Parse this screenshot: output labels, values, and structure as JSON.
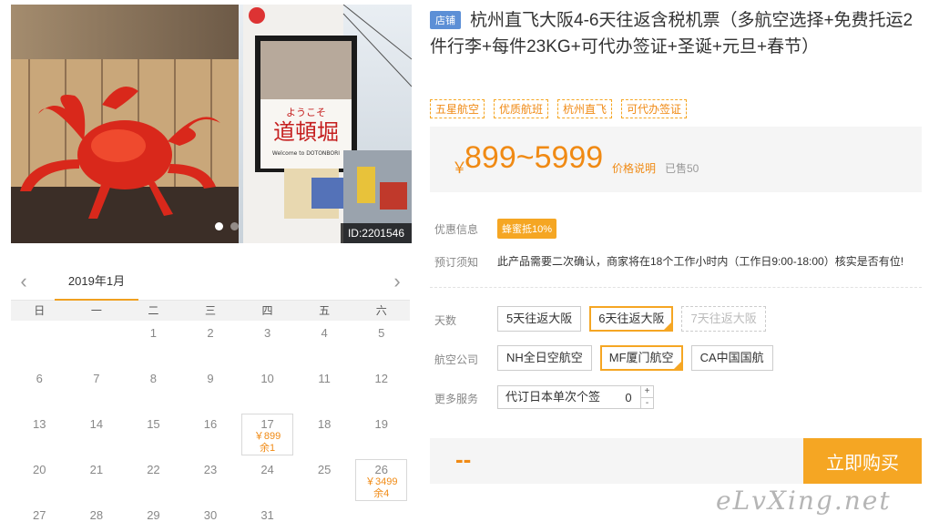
{
  "photo": {
    "id_label": "ID:2201546",
    "sign_text_small": "ようこそ",
    "sign_text_big": "道頓堀",
    "sign_text_sub": "Welcome to DOTONBORI",
    "slide_count": 2,
    "active_slide": 1
  },
  "calendar": {
    "month_label": "2019年1月",
    "prev_icon": "chevron-left-icon",
    "next_icon": "chevron-right-icon",
    "weekdays": [
      "日",
      "一",
      "二",
      "三",
      "四",
      "五",
      "六"
    ],
    "days": [
      {
        "day": ""
      },
      {
        "day": ""
      },
      {
        "day": "1"
      },
      {
        "day": "2"
      },
      {
        "day": "3"
      },
      {
        "day": "4"
      },
      {
        "day": "5"
      },
      {
        "day": "6"
      },
      {
        "day": "7"
      },
      {
        "day": "8"
      },
      {
        "day": "9"
      },
      {
        "day": "10"
      },
      {
        "day": "11"
      },
      {
        "day": "12"
      },
      {
        "day": "13"
      },
      {
        "day": "14"
      },
      {
        "day": "15"
      },
      {
        "day": "16"
      },
      {
        "day": "17",
        "price": "￥899",
        "stock": "余1"
      },
      {
        "day": "18"
      },
      {
        "day": "19"
      },
      {
        "day": "20"
      },
      {
        "day": "21"
      },
      {
        "day": "22"
      },
      {
        "day": "23"
      },
      {
        "day": "24"
      },
      {
        "day": "25"
      },
      {
        "day": "26",
        "price": "￥3499",
        "stock": "余4"
      },
      {
        "day": "27"
      },
      {
        "day": "28"
      },
      {
        "day": "29"
      },
      {
        "day": "30"
      },
      {
        "day": "31"
      },
      {
        "day": ""
      },
      {
        "day": ""
      }
    ]
  },
  "product": {
    "shop_badge": "店铺",
    "title": "杭州直飞大阪4-6天往返含税机票（多航空选择+免费托运2件行李+每件23KG+可代办签证+圣诞+元旦+春节）",
    "tags": [
      "五星航空",
      "优质航班",
      "杭州直飞",
      "可代办签证"
    ],
    "price_currency": "￥",
    "price_range": "899~5999",
    "price_note": "价格说明",
    "sold": "已售50"
  },
  "info": {
    "discount_label": "优惠信息",
    "discount_badge": "蜂蜜抵10%",
    "notice_label": "预订须知",
    "notice_text": "此产品需要二次确认，商家将在18个工作小时内（工作日9:00-18:00）核实是否有位!"
  },
  "options": {
    "days_label": "天数",
    "days": [
      {
        "label": "5天往返大阪",
        "state": "normal"
      },
      {
        "label": "6天往返大阪",
        "state": "selected"
      },
      {
        "label": "7天往返大阪",
        "state": "disabled"
      }
    ],
    "airline_label": "航空公司",
    "airlines": [
      {
        "label": "NH全日空航空",
        "state": "normal"
      },
      {
        "label": "MF厦门航空",
        "state": "selected"
      },
      {
        "label": "CA中国国航",
        "state": "normal"
      }
    ],
    "service_label": "更多服务",
    "service_name": "代订日本单次个签",
    "service_qty": "0",
    "plus": "+",
    "minus": "-"
  },
  "buy": {
    "total": "--",
    "button": "立即购买"
  },
  "watermark": "eLvXing.net",
  "colors": {
    "accent": "#f5a623",
    "price": "#f08a14",
    "badge_blue": "#5c8fd6"
  }
}
